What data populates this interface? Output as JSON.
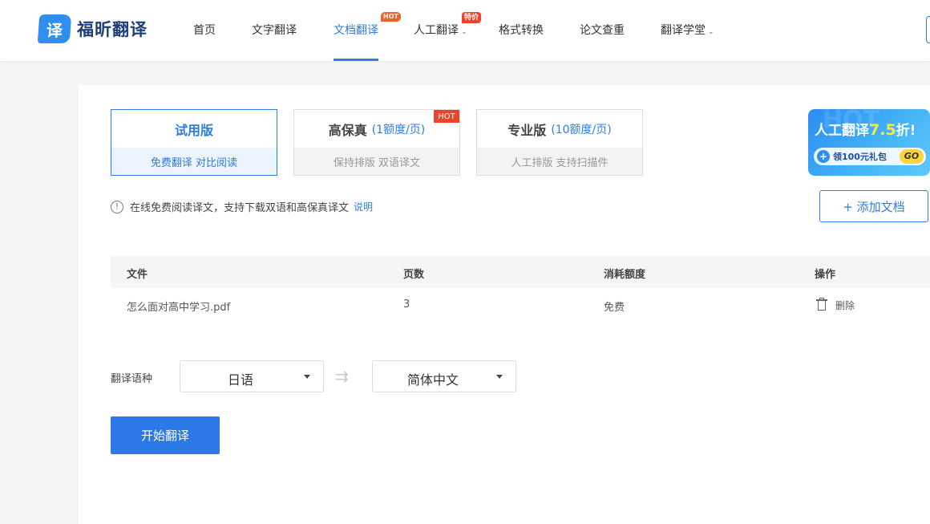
{
  "brand": {
    "logo_char": "译",
    "name": "福昕翻译"
  },
  "nav": {
    "items": [
      {
        "label": "首页"
      },
      {
        "label": "文字翻译"
      },
      {
        "label": "文档翻译",
        "badge": "HOT",
        "active": true
      },
      {
        "label": "人工翻译",
        "badge": "特价",
        "dropdown_icon": "chevron-down-icon"
      },
      {
        "label": "格式转换"
      },
      {
        "label": "论文查重"
      },
      {
        "label": "翻译学堂",
        "dropdown_icon": "chevron-down-icon"
      }
    ]
  },
  "plans": [
    {
      "title": "试用版",
      "sub": "",
      "desc": "免费翻译  对比阅读",
      "selected": true
    },
    {
      "title": "高保真",
      "sub": "(1额度/页)",
      "desc": "保持排版  双语译文",
      "badge": "HOT"
    },
    {
      "title": "专业版",
      "sub": "(10额度/页)",
      "desc": "人工排版  支持扫描件"
    }
  ],
  "promo": {
    "ghost": "HOT",
    "title_prefix": "人工翻译",
    "title_num": "7.5",
    "title_suffix": "折!",
    "gift": "领100元礼包",
    "go": "GO"
  },
  "notice": {
    "icon": "info-icon",
    "text": "在线免费阅读译文，支持下载双语和高保真译文",
    "link": "说明"
  },
  "add_button": {
    "label": "+ 添加文档"
  },
  "table": {
    "headers": [
      "文件",
      "页数",
      "消耗额度",
      "操作"
    ],
    "rows": [
      {
        "file": "怎么面对高中学习.pdf",
        "pages": "3",
        "cost": "免费",
        "action_icon": "trash-icon",
        "action": "删除"
      }
    ]
  },
  "language": {
    "label": "翻译语种",
    "source": "日语",
    "swap_icon": "swap-arrow-icon",
    "target": "简体中文"
  },
  "start_button": {
    "label": "开始翻译"
  },
  "colors": {
    "accent": "#2f7de1",
    "primary_button": "#2a79e6",
    "hot_badge": "#e8452b"
  }
}
